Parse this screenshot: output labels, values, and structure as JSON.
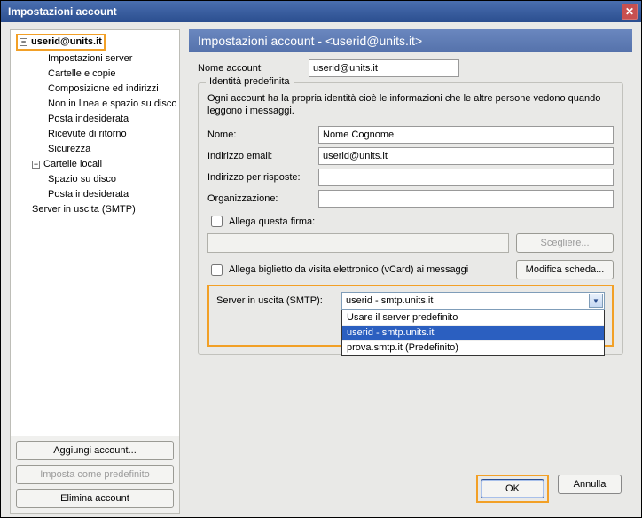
{
  "window": {
    "title": "Impostazioni account"
  },
  "tree": {
    "account_root": "userid@units.it",
    "account_items": [
      "Impostazioni server",
      "Cartelle e copie",
      "Composizione ed indirizzi",
      "Non in linea e spazio su disco",
      "Posta indesiderata",
      "Ricevute di ritorno",
      "Sicurezza"
    ],
    "local_root": "Cartelle locali",
    "local_items": [
      "Spazio su disco",
      "Posta indesiderata"
    ],
    "smtp_item": "Server in uscita (SMTP)"
  },
  "sidebar_buttons": {
    "add": "Aggiungi account...",
    "default": "Imposta come predefinito",
    "delete": "Elimina account"
  },
  "header": "Impostazioni account - <userid@units.it>",
  "form": {
    "account_name_label": "Nome account:",
    "account_name_value": "userid@units.it",
    "fieldset_legend": "Identità predefinita",
    "description": "Ogni account ha la propria identità cioè le informazioni che le altre persone vedono quando leggono i messaggi.",
    "name_label": "Nome:",
    "name_value": "Nome Cognome",
    "email_label": "Indirizzo email:",
    "email_value": "userid@units.it",
    "reply_label": "Indirizzo per risposte:",
    "reply_value": "",
    "org_label": "Organizzazione:",
    "org_value": "",
    "sig_check_label": "Allega questa firma:",
    "sig_value": "",
    "choose_btn": "Scegliere...",
    "vcard_check_label": "Allega biglietto da visita elettronico (vCard) ai messaggi",
    "edit_card_btn": "Modifica scheda...",
    "smtp_label": "Server in uscita (SMTP):",
    "smtp_selected": "userid - smtp.units.it",
    "smtp_options": [
      "Usare il server predefinito",
      "userid - smtp.units.it",
      "prova.smtp.it (Predefinito)"
    ]
  },
  "footer": {
    "ok": "OK",
    "cancel": "Annulla"
  }
}
